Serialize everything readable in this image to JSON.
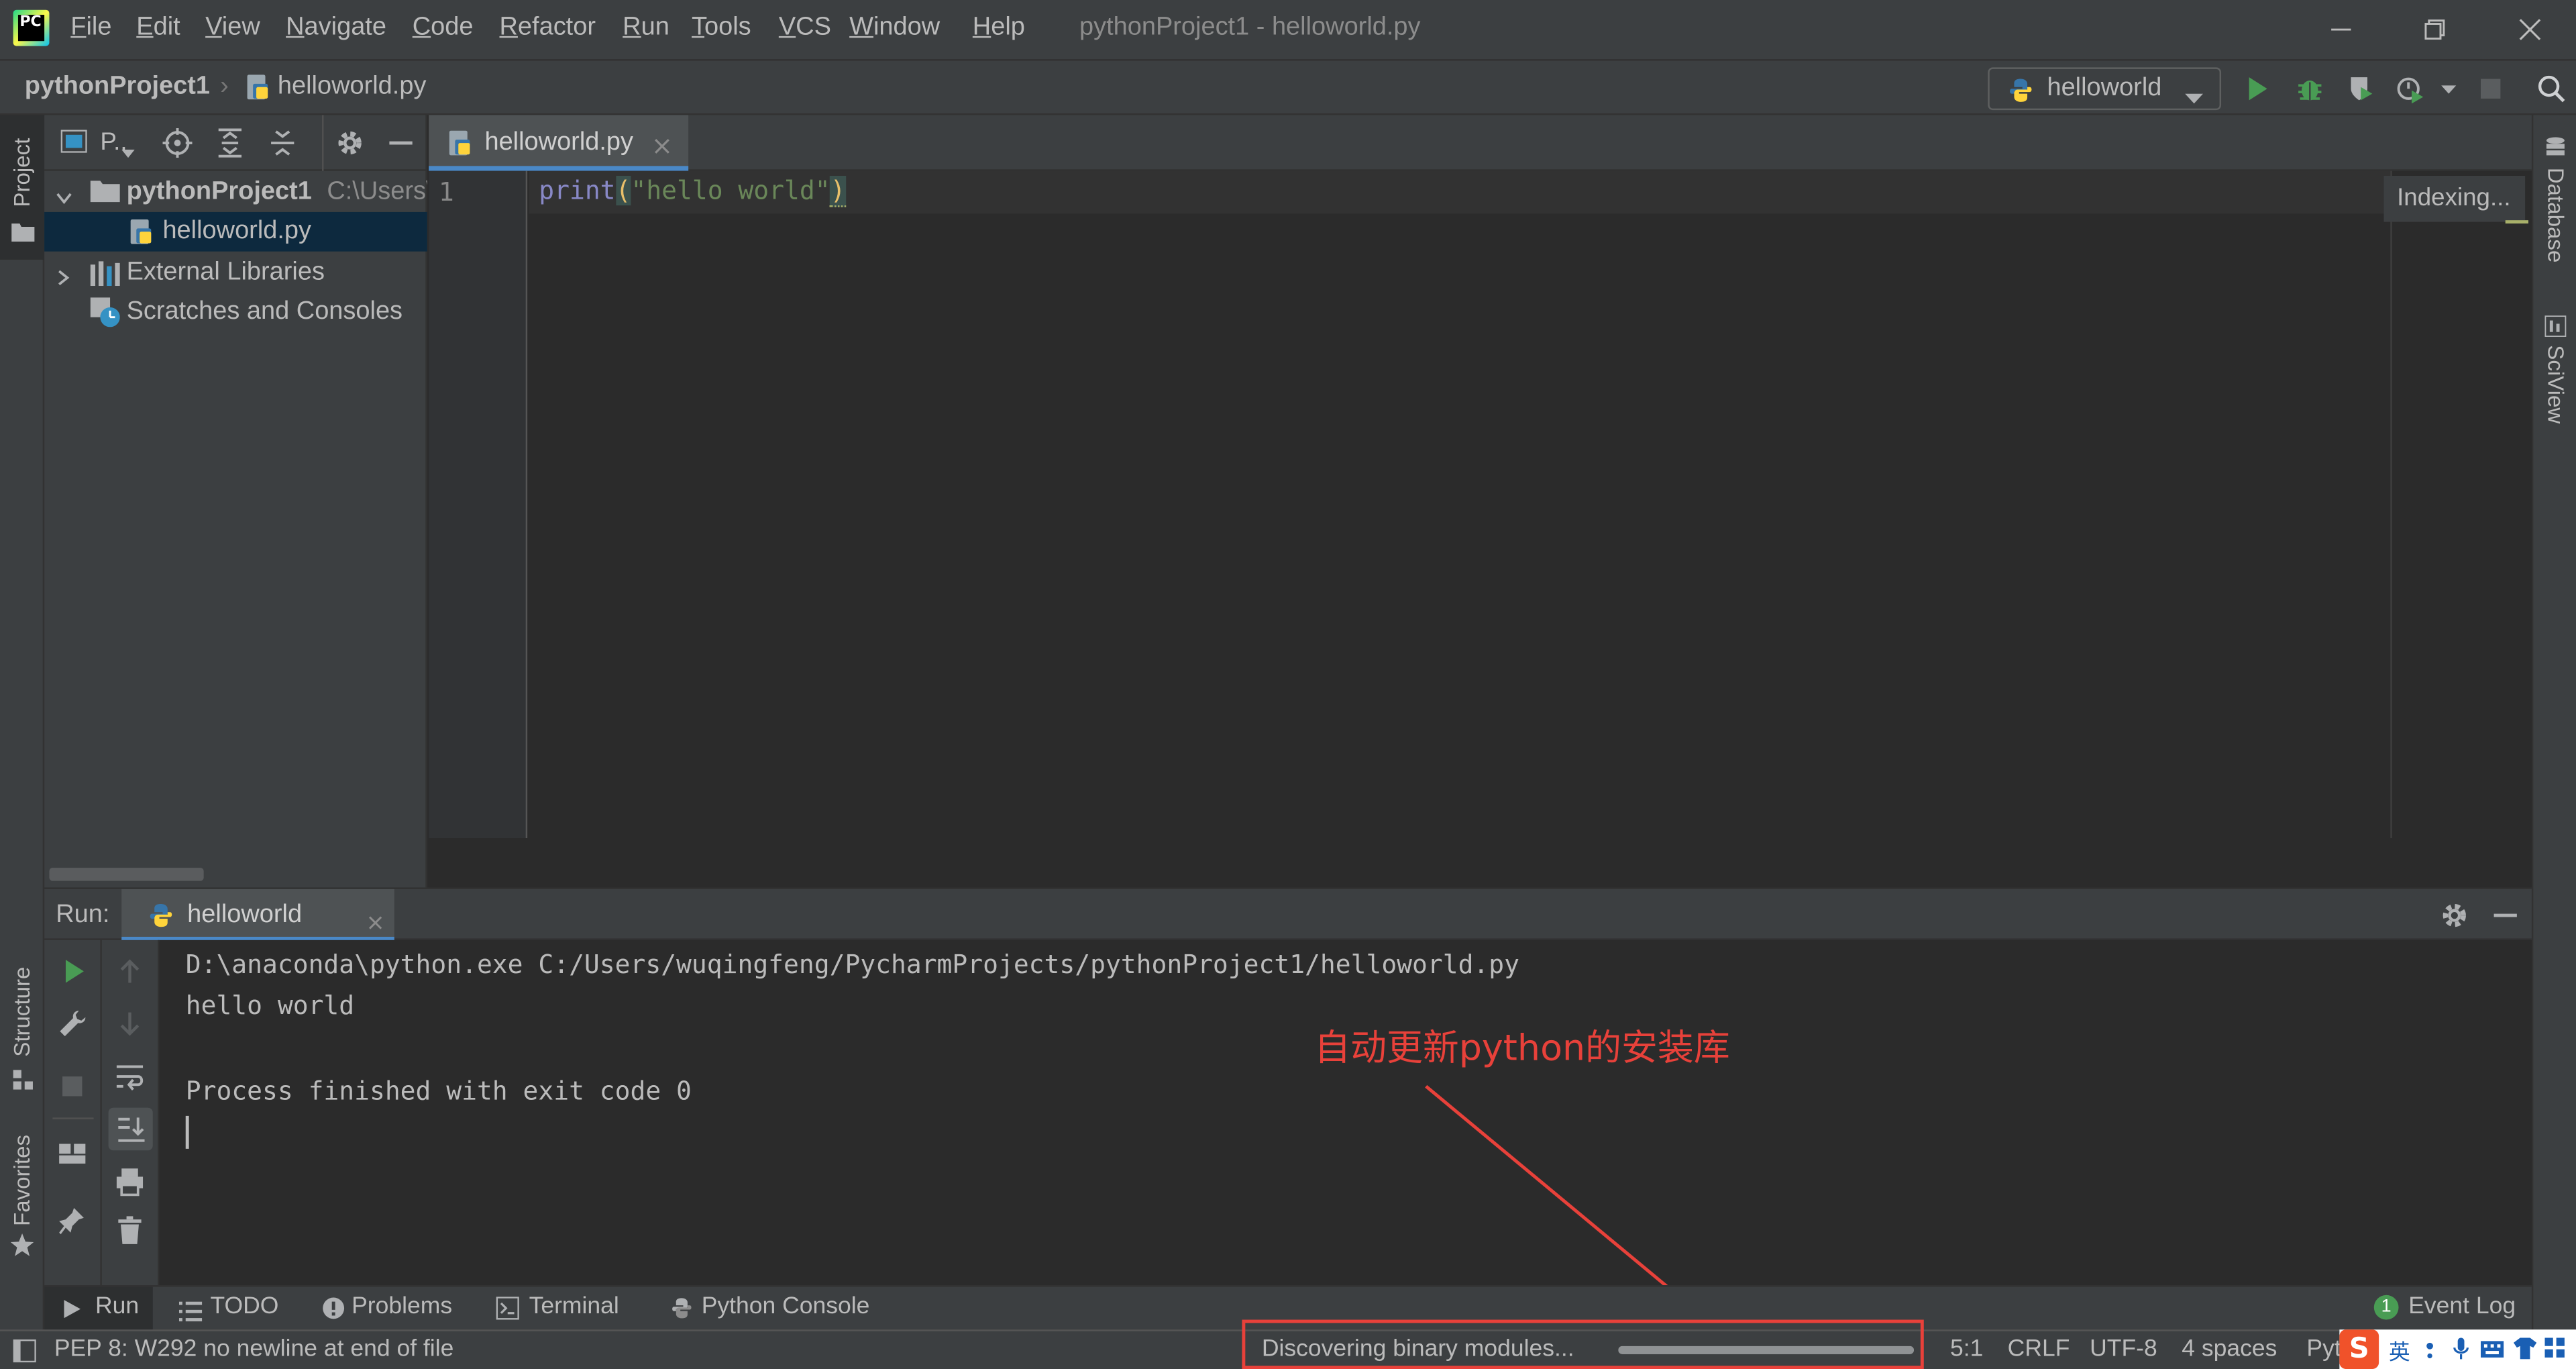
{
  "app": {
    "window_title": "pythonProject1 - helloworld.py",
    "logo_text": "PC"
  },
  "menu": [
    "File",
    "Edit",
    "View",
    "Navigate",
    "Code",
    "Refactor",
    "Run",
    "Tools",
    "VCS",
    "Window",
    "Help"
  ],
  "breadcrumb": {
    "project": "pythonProject1",
    "file": "helloworld.py"
  },
  "toolbar": {
    "run_config": "helloworld"
  },
  "left_stripe": {
    "project": "Project",
    "structure": "Structure",
    "favorites": "Favorites"
  },
  "right_stripe": {
    "database": "Database",
    "sciview": "SciView"
  },
  "project_panel": {
    "view_label": "P..",
    "tree": [
      {
        "label": "pythonProject1",
        "suffix": "C:\\Users\\"
      },
      {
        "label": "helloworld.py"
      },
      {
        "label": "External Libraries"
      },
      {
        "label": "Scratches and Consoles"
      }
    ]
  },
  "editor": {
    "tab_label": "helloworld.py",
    "line_number": "1",
    "code": {
      "func": "print",
      "open_paren": "(",
      "string": "\"hello world\"",
      "close_paren": ")"
    },
    "indexing_label": "Indexing..."
  },
  "run_panel": {
    "title": "Run:",
    "tab_label": "helloworld",
    "console_lines": [
      "D:\\anaconda\\python.exe C:/Users/wuqingfeng/PycharmProjects/pythonProject1/helloworld.py",
      "hello world",
      "",
      "Process finished with exit code 0"
    ]
  },
  "annotation": {
    "text": "自动更新python的安装库",
    "color": "#e8413a"
  },
  "tool_tabs": [
    {
      "label": "Run",
      "icon": "play-icon"
    },
    {
      "label": "TODO",
      "icon": "list-icon"
    },
    {
      "label": "Problems",
      "icon": "info-icon"
    },
    {
      "label": "Terminal",
      "icon": "terminal-icon"
    },
    {
      "label": "Python Console",
      "icon": "python-icon"
    }
  ],
  "event_log": {
    "badge": "1",
    "label": "Event Log"
  },
  "status_bar": {
    "message": "PEP 8: W292 no newline at end of file",
    "progress_text": "Discovering binary modules...",
    "position": "5:1",
    "line_sep": "CRLF",
    "encoding": "UTF-8",
    "indent": "4 spaces",
    "interpreter": "Pyt",
    "ime_label": "英"
  },
  "colors": {
    "accent": "#4a88c7",
    "run_green": "#499c54",
    "annotation_red": "#e8413a",
    "keyword_print": "#8888c6",
    "string_green": "#6a8759",
    "paren_yellow": "#e8bf6a"
  }
}
